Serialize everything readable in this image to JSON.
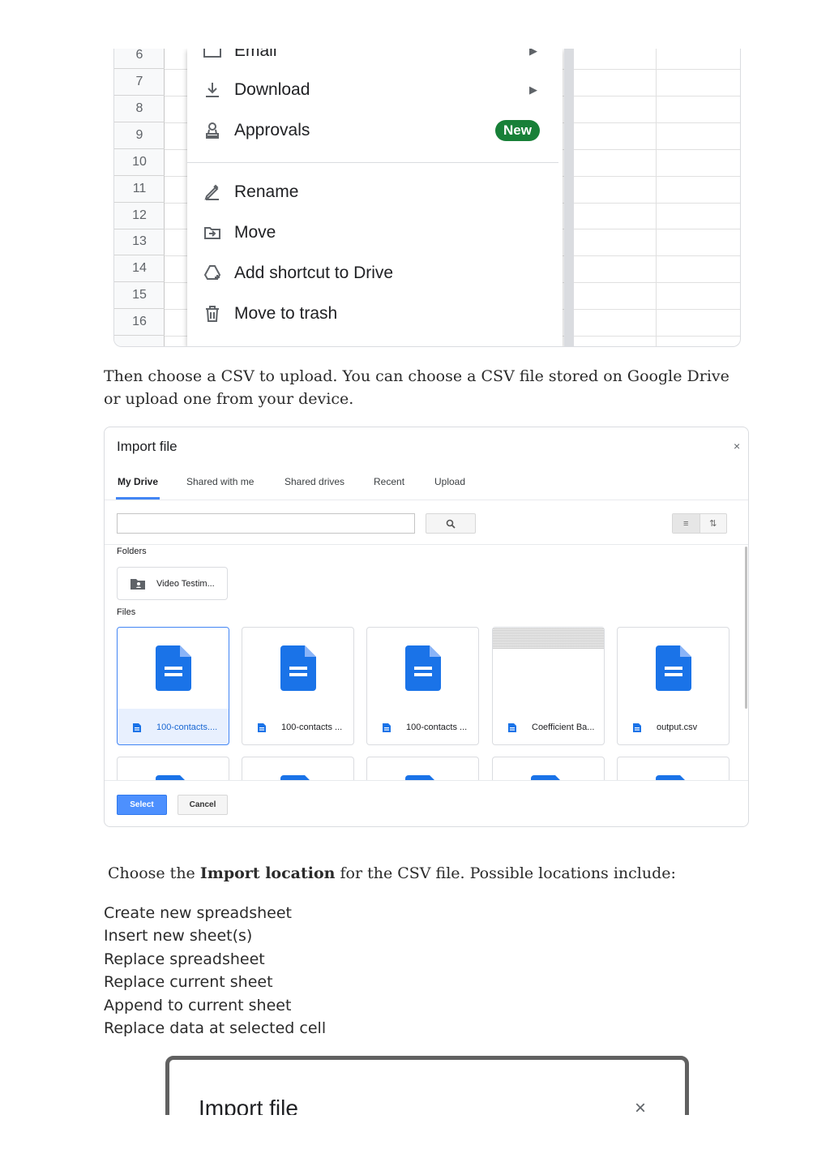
{
  "sheet": {
    "row_numbers": [
      "6",
      "7",
      "8",
      "9",
      "10",
      "11",
      "12",
      "13",
      "14",
      "15",
      "16"
    ]
  },
  "menu": {
    "partial_top_label": "Email",
    "items": [
      {
        "label": "Download",
        "icon": "download-icon",
        "has_submenu": true
      },
      {
        "label": "Approvals",
        "icon": "approvals-icon",
        "badge": "New"
      },
      {
        "label": "Rename",
        "icon": "rename-icon"
      },
      {
        "label": "Move",
        "icon": "move-icon"
      },
      {
        "label": "Add shortcut to Drive",
        "icon": "add-shortcut-icon"
      },
      {
        "label": "Move to trash",
        "icon": "trash-icon"
      }
    ],
    "badge_color": "#188038"
  },
  "text": {
    "para1": "Then choose a CSV to upload. You can choose a CSV file stored on Google Drive or upload one from your device.",
    "para2_before": "Choose the ",
    "para2_bold": "Import location",
    "para2_after": " for the CSV file. Possible locations include:",
    "locations": [
      "Create new spreadsheet",
      "Insert new sheet(s)",
      "Replace spreadsheet",
      "Replace current sheet",
      "Append to current sheet",
      "Replace data at selected cell"
    ]
  },
  "import_dialog": {
    "title": "Import file",
    "close": "×",
    "tabs": [
      "My Drive",
      "Shared with me",
      "Shared drives",
      "Recent",
      "Upload"
    ],
    "active_tab": "My Drive",
    "search_value": "",
    "folders_label": "Folders",
    "folders": [
      "Video Testim..."
    ],
    "files_label": "Files",
    "files": [
      "100-contacts....",
      "100-contacts ...",
      "100-contacts ...",
      "Coefficient Ba...",
      "output.csv"
    ],
    "select_label": "Select",
    "cancel_label": "Cancel",
    "accent_color": "#4285f4"
  },
  "second_dialog": {
    "title": "Import file",
    "close": "×"
  }
}
